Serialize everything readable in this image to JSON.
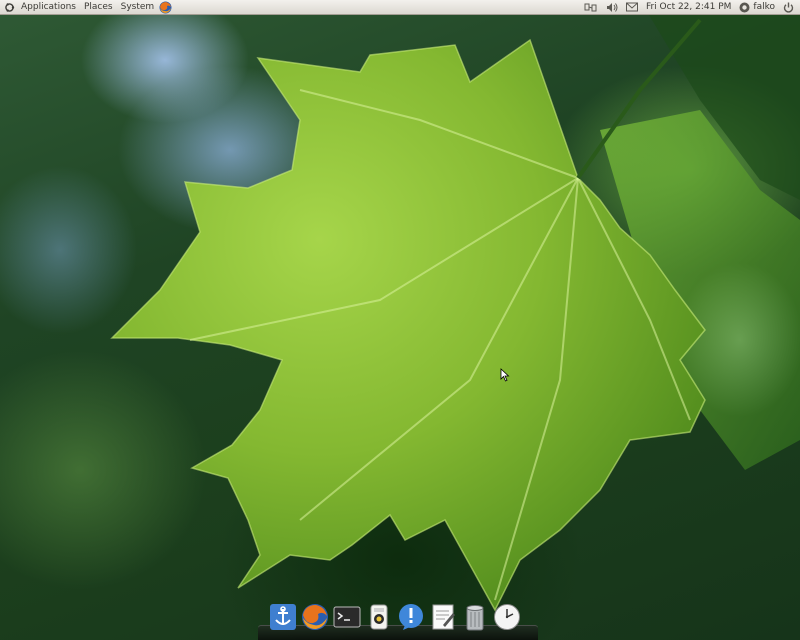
{
  "top_panel": {
    "menus": {
      "applications": "Applications",
      "places": "Places",
      "system": "System"
    },
    "clock": "Fri Oct 22,  2:41 PM",
    "user": "falko",
    "icons": {
      "logo": "ubuntu-logo-icon",
      "browser": "firefox-icon",
      "network": "network-icon",
      "volume": "volume-icon",
      "mail": "mail-icon",
      "user_status": "user-status-icon",
      "power": "power-icon"
    }
  },
  "dock": {
    "items": [
      "anchor-icon",
      "firefox-icon",
      "terminal-icon",
      "media-player-icon",
      "notification-icon",
      "text-editor-icon",
      "trash-icon",
      "clock-icon"
    ]
  },
  "colors": {
    "panel_bg": "#dcd8d1",
    "leaf_green": "#8fc63a",
    "background_green": "#1f4424"
  }
}
